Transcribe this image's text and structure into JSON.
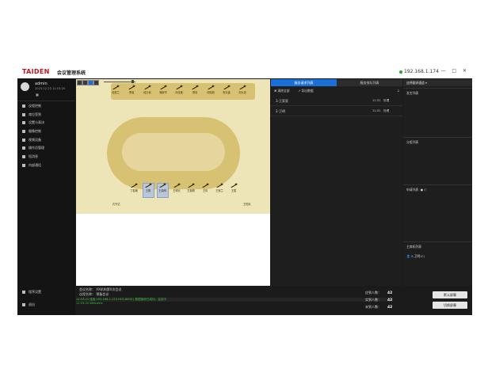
{
  "titlebar": {
    "logo": "TAIDEN",
    "title": "会议管理系统",
    "ip": "192.168.1.174",
    "window_buttons": "— □ ✕"
  },
  "user": {
    "name": "admin",
    "datetime": "2023-12-23 11:53:24",
    "lock_glyph": "■"
  },
  "sidebar": {
    "items": [
      {
        "label": "议程控制"
      },
      {
        "label": "席位签到"
      },
      {
        "label": "设置与表决"
      },
      {
        "label": "摄像控制"
      },
      {
        "label": "视频设备"
      },
      {
        "label": "操作员管理"
      },
      {
        "label": "短消息"
      },
      {
        "label": "内部通话"
      }
    ]
  },
  "sidebar_bottom": {
    "settings": "程序设置",
    "exit": "退出"
  },
  "seats": {
    "top_row": [
      "包惠兰",
      "曹瑞",
      "段万民",
      "蒋新华",
      "孙佳莲",
      "周欢",
      "何晓燕",
      "宋天鑫",
      "刘大忠"
    ],
    "oval_top": [
      "丁若瑜",
      "王刚",
      "王源明",
      "王明元",
      "王泰顺",
      "王倩",
      "王家兰",
      "王胜"
    ],
    "oval_bottom": [
      "刘晨兰",
      "沈素兰",
      "蒋建明",
      "计远程",
      "许群帆",
      "严海宇",
      "卢晓红",
      "石健强",
      "张冲印"
    ],
    "oval_left": [
      "孔令达",
      "同德中",
      "王晓明"
    ],
    "oval_right": [
      "王旺民",
      "何凯明",
      "王丽花"
    ],
    "bottom_row": [
      "顾子冰",
      "冯平",
      "吴会铃",
      "陈家云",
      "郭立强",
      "周冬梅",
      "陈达光",
      "彭国辉",
      "谭晓瑞"
    ]
  },
  "middle": {
    "tab_active": "服务请求列表",
    "tab_inactive": "服务排队列表",
    "tool_clear": "清除全部",
    "tool_export": "导出数据",
    "count": "2",
    "speakers": [
      {
        "name": "3-王家家",
        "time": "11:31",
        "add": "处理"
      },
      {
        "name": "2-卫明",
        "time": "11:31",
        "add": "处理"
      }
    ]
  },
  "right": {
    "select": "选择翻译通道",
    "sections": {
      "speaking": "发言列表",
      "separate": "分组列表",
      "apply": "申请列表",
      "main": "主席机列表"
    },
    "main_item": "2-卫明(C)",
    "apply_dots": "●  ○"
  },
  "bottom": {
    "meeting_label": "会议名称：",
    "meeting_value": "XX机构第X次会议",
    "agenda_label": "议程名称：",
    "agenda_value": "预备会议",
    "log_lines": [
      "11:53:21   连接 192.168.1.174 HCS-8000 | 数据接收已成功，监控中",
      "11:53:20   Welcome"
    ],
    "stats": {
      "due_label": "应到人数：",
      "due": "42",
      "present_label": "实到人数：",
      "present": "42",
      "absent_label": "未到人数：",
      "absent": "42"
    },
    "btn_mic_on": "默认屏幕",
    "btn_screen": "切换屏幕"
  }
}
